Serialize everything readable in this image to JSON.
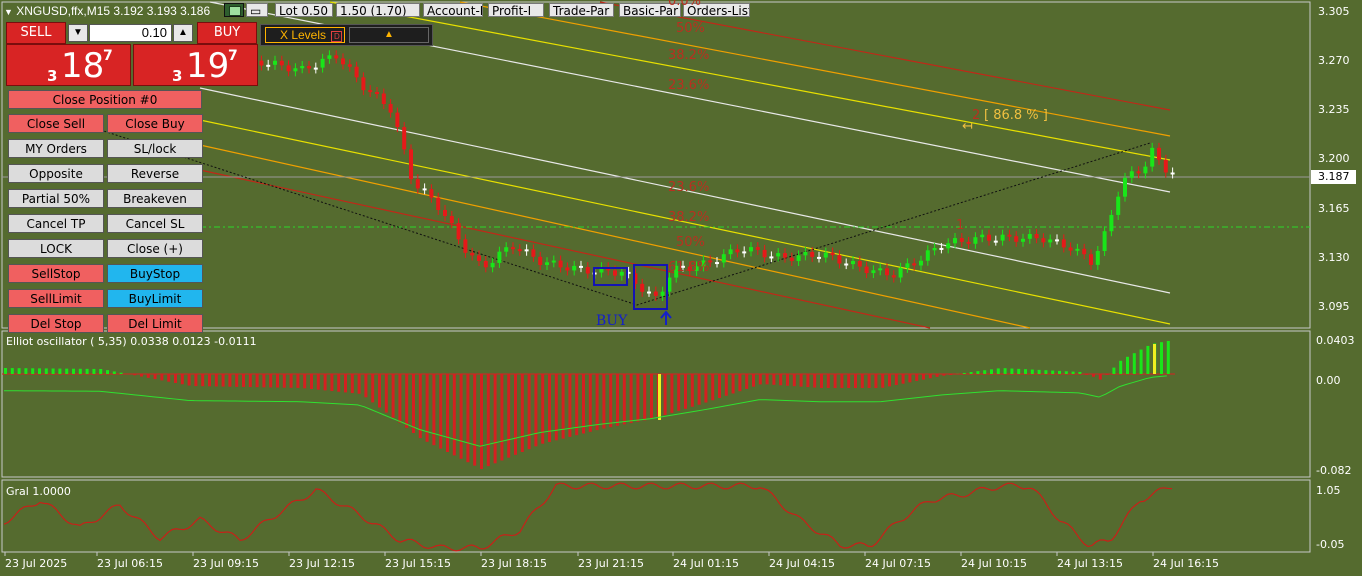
{
  "window": {
    "symbol_line": "XNGUSD,ffx,M15  3.192 3.193 3.186"
  },
  "toolbar": {
    "lot_label": "Lot 0.50",
    "lot_value": "1.50 (1.70)",
    "tabs": [
      "Account-I",
      "Profit-I",
      "Trade-Par",
      "Basic-Par",
      "Orders-List"
    ]
  },
  "trade_panel": {
    "sell_label": "SELL",
    "buy_label": "BUY",
    "lot_input": "0.10",
    "sell_price_small": "3",
    "sell_price_big": "18",
    "sell_price_sup": "7",
    "buy_price_small": "3",
    "buy_price_big": "19",
    "buy_price_sup": "7",
    "close_position": "Close Position #0",
    "buttons": [
      [
        "Close Sell",
        "Close Buy"
      ],
      [
        "MY Orders",
        "SL/lock"
      ],
      [
        "Opposite",
        "Reverse"
      ],
      [
        "Partial 50%",
        "Breakeven"
      ],
      [
        "Cancel TP",
        "Cancel SL"
      ],
      [
        "LOCK",
        "Close (+)"
      ],
      [
        "SellStop",
        "BuyStop"
      ],
      [
        "SellLimit",
        "BuyLimit"
      ],
      [
        "Del Stop",
        "Del Limit"
      ]
    ],
    "xlevels_label": "X Levels"
  },
  "main_chart": {
    "price_axis": [
      "3.305",
      "3.270",
      "3.235",
      "3.200",
      "3.165",
      "3.130",
      "3.095"
    ],
    "current_price": "3.187",
    "fib_upper": [
      "0.0%",
      "50%",
      "38.2%",
      "23.6%"
    ],
    "fib_lower": [
      "23.6%",
      "38.2%",
      "50%",
      "61.8%"
    ],
    "wave_label_1": "1",
    "wave_label_2": "2",
    "wave_pct": "[ 86.8 % ]",
    "buy_label": "BUY"
  },
  "oscillator": {
    "title": "Elliot oscillator ( 5,35) 0.0338 0.0123 -0.0111",
    "axis": [
      "0.0403",
      "0.00",
      "-0.082"
    ]
  },
  "gral": {
    "title": "Gral 1.0000",
    "axis": [
      "1.05",
      "-0.05"
    ]
  },
  "time_axis": [
    "23 Jul 2025",
    "23 Jul 06:15",
    "23 Jul 09:15",
    "23 Jul 12:15",
    "23 Jul 15:15",
    "23 Jul 18:15",
    "23 Jul 21:15",
    "24 Jul 01:15",
    "24 Jul 04:15",
    "24 Jul 07:15",
    "24 Jul 10:15",
    "24 Jul 13:15",
    "24 Jul 16:15"
  ],
  "colors": {
    "background": "#556b2f",
    "bull": "#19e619",
    "bear": "#e61919",
    "neutral": "#ffffff",
    "fib": "#b83020"
  }
}
